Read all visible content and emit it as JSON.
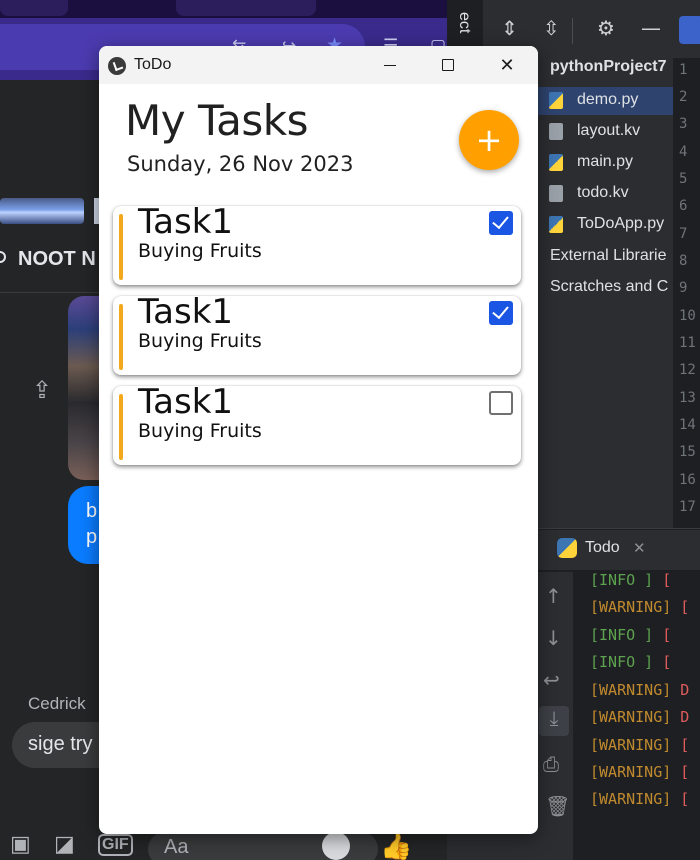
{
  "window": {
    "title": "ToDo"
  },
  "app": {
    "heading": "My Tasks",
    "date": "Sunday, 26 Nov 2023",
    "fab_label": "+",
    "accent_color": "#ffa000",
    "checkbox_color": "#1a55e3"
  },
  "tasks": [
    {
      "title": "Task1",
      "description": "Buying Fruits",
      "completed": true
    },
    {
      "title": "Task1",
      "description": "Buying Fruits",
      "completed": true
    },
    {
      "title": "Task1",
      "description": "Buying Fruits",
      "completed": false
    }
  ],
  "background_messenger": {
    "conversation_name": "NOOT N",
    "bubble_text": "b\np",
    "sender": "Cedrick",
    "incoming_text": "sige try",
    "gif_label": "GIF",
    "composer_placeholder": "Aa"
  },
  "background_ide": {
    "project_tab": "ect",
    "project_name": "pythonProject7",
    "files": [
      {
        "name": "demo.py",
        "selected": true
      },
      {
        "name": "layout.kv",
        "selected": false
      },
      {
        "name": "main.py",
        "selected": false
      },
      {
        "name": "todo.kv",
        "selected": false
      },
      {
        "name": "ToDoApp.py",
        "selected": false
      }
    ],
    "external_libraries": "External Librarie",
    "scratches": "Scratches and C",
    "line_numbers": [
      "1",
      "2",
      "3",
      "4",
      "5",
      "6",
      "7",
      "8",
      "9",
      "10",
      "11",
      "12",
      "13",
      "14",
      "15",
      "16",
      "17"
    ],
    "run_tab_title": "Todo",
    "log_lines": [
      {
        "level": "[INFO   ]",
        "rest": " ["
      },
      {
        "level": "[WARNING]",
        "rest": " ["
      },
      {
        "level": "[INFO   ]",
        "rest": " ["
      },
      {
        "level": "[INFO   ]",
        "rest": " ["
      },
      {
        "level": "[WARNING]",
        "rest": " D"
      },
      {
        "level": "[WARNING]",
        "rest": " D"
      },
      {
        "level": "[WARNING]",
        "rest": " ["
      },
      {
        "level": "[WARNING]",
        "rest": " ["
      },
      {
        "level": "[WARNING]",
        "rest": " ["
      }
    ]
  }
}
